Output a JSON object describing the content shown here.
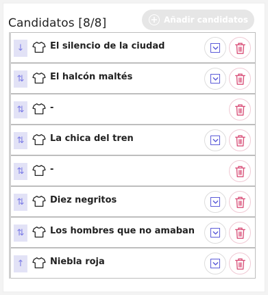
{
  "header": {
    "title": "Candidatos [8/8]",
    "add_label": "Añadir candidatos"
  },
  "colors": {
    "accent": "#5a5ad8",
    "drag_bg": "#e2e2f6",
    "danger": "#d94f78",
    "disabled_button": "#e6e6e6"
  },
  "candidates": [
    {
      "name": "El silencio de la ciudad",
      "drag_icon": "arrow-down-icon",
      "has_expand": true
    },
    {
      "name": "El halcón maltés",
      "drag_icon": "arrows-up-down-icon",
      "has_expand": true
    },
    {
      "name": "-",
      "drag_icon": "arrows-up-down-icon",
      "has_expand": false
    },
    {
      "name": "La chica del tren",
      "drag_icon": "arrows-up-down-icon",
      "has_expand": true
    },
    {
      "name": "-",
      "drag_icon": "arrows-up-down-icon",
      "has_expand": false
    },
    {
      "name": "Diez negritos",
      "drag_icon": "arrows-up-down-icon",
      "has_expand": true
    },
    {
      "name": "Los hombres que no amaban",
      "drag_icon": "arrows-up-down-icon",
      "has_expand": true
    },
    {
      "name": "Niebla roja",
      "drag_icon": "arrow-up-icon",
      "has_expand": true
    }
  ]
}
